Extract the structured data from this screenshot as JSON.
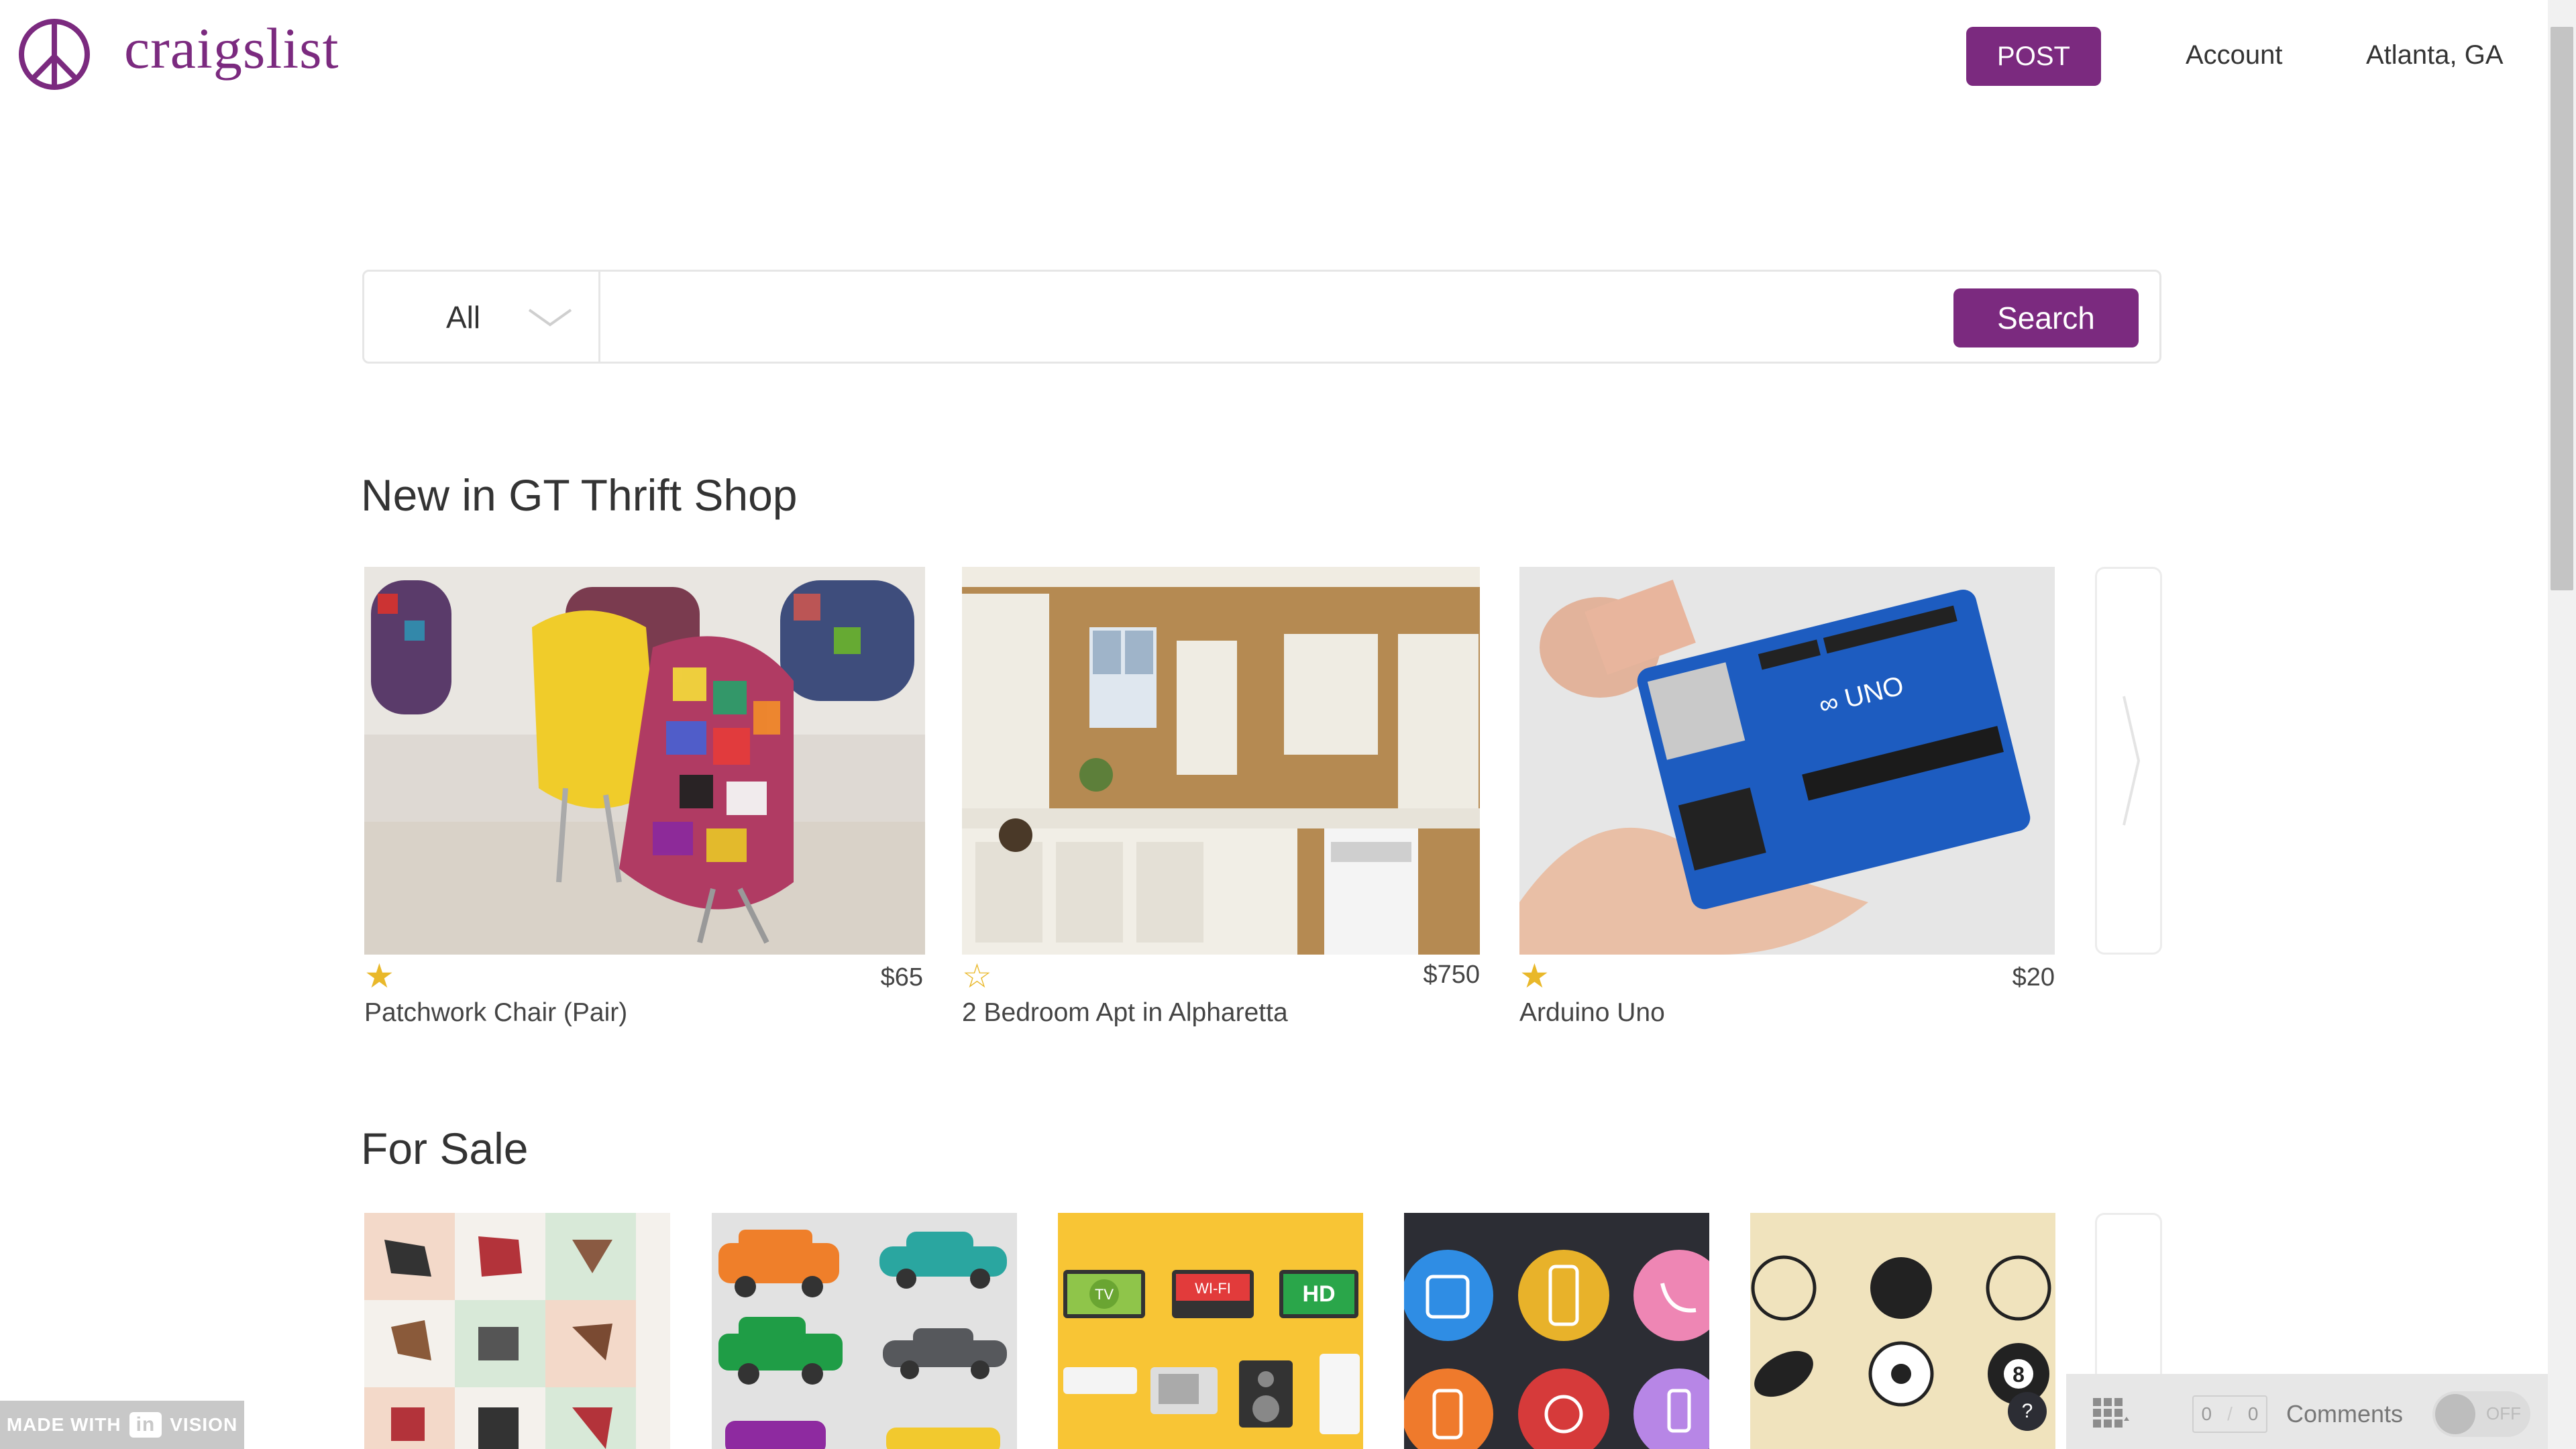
{
  "header": {
    "logo_text": "craigslist",
    "post_label": "POST",
    "account_label": "Account",
    "location_label": "Atlanta, GA"
  },
  "search": {
    "category_value": "All",
    "input_value": "",
    "button_label": "Search"
  },
  "sections": {
    "new_title": "New in GT Thrift Shop",
    "sale_title": "For Sale"
  },
  "listings": [
    {
      "title": "Patchwork Chair (Pair)",
      "price": "$65",
      "starred": true
    },
    {
      "title": "2 Bedroom Apt in Alpharetta",
      "price": "$750",
      "starred": false
    },
    {
      "title": "Arduino Uno",
      "price": "$20",
      "starred": true
    }
  ],
  "for_sale_tiles": [
    "furniture",
    "cars",
    "electronics",
    "phones",
    "sports"
  ],
  "electronics_labels": {
    "tv": "TV",
    "wifi": "WI-FI",
    "hd": "HD"
  },
  "footer": {
    "invision_text": "MADE WITH",
    "invision_logo": "in",
    "invision_brand": "VISION",
    "comment_count_a": "0",
    "comment_count_b": "0",
    "comments_label": "Comments",
    "toggle_label": "OFF",
    "help_label": "?"
  },
  "colors": {
    "brand": "#7b2a7f",
    "star": "#e9b82a"
  }
}
